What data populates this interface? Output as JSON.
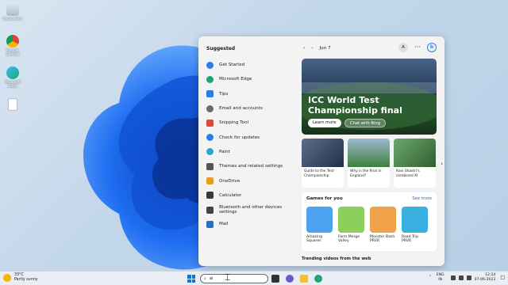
{
  "desktop": {
    "icons": [
      {
        "label": "Recycle Bin",
        "icon": "recycle-bin-icon"
      },
      {
        "label": "Google Chrome",
        "icon": "chrome-icon"
      },
      {
        "label": "Microsoft Edge",
        "icon": "edge-icon"
      },
      {
        "label": "",
        "icon": "file-icon"
      }
    ]
  },
  "search_panel": {
    "suggested_title": "Suggested",
    "suggested": [
      {
        "label": "Get Started",
        "icon": "get-started-icon",
        "color": "#2b7de9"
      },
      {
        "label": "Microsoft Edge",
        "icon": "edge-icon",
        "color": "#1fa37a"
      },
      {
        "label": "Tips",
        "icon": "tips-icon",
        "color": "#2b7de9"
      },
      {
        "label": "Email and accounts",
        "icon": "person-icon",
        "color": "#6b6b6b"
      },
      {
        "label": "Snipping Tool",
        "icon": "snipping-tool-icon",
        "color": "#d94a3a"
      },
      {
        "label": "Check for updates",
        "icon": "update-icon",
        "color": "#2b7de9"
      },
      {
        "label": "Paint",
        "icon": "paint-icon",
        "color": "#2aa5d8"
      },
      {
        "label": "Themes and related settings",
        "icon": "brush-icon",
        "color": "#555555"
      },
      {
        "label": "OneDrive",
        "icon": "onedrive-icon",
        "color": "#e0a020"
      },
      {
        "label": "Calculator",
        "icon": "calculator-icon",
        "color": "#3a3a3a"
      },
      {
        "label": "Bluetooth and other devices settings",
        "icon": "bluetooth-icon",
        "color": "#444444"
      },
      {
        "label": "Mail",
        "icon": "mail-icon",
        "color": "#2b6cc0"
      }
    ],
    "date": "Jun 7",
    "avatar_letter": "A",
    "more_label": "···",
    "bing_label": "b",
    "hero": {
      "title": "ICC World Test Championship final",
      "learn_more": "Learn more",
      "chat_bing": "Chat with Bing"
    },
    "cards": [
      {
        "text": "Guide to the Test Championship"
      },
      {
        "text": "Why is the final in England?"
      },
      {
        "text": "Ravi Shastri's combined XI"
      }
    ],
    "games": {
      "title": "Games for you",
      "see_more": "See more",
      "items": [
        {
          "name": "Amazing Squares",
          "color": "#4da3f0"
        },
        {
          "name": "Farm Merge Valley",
          "color": "#8ccf5a"
        },
        {
          "name": "Monster Bash PRVR",
          "color": "#f0a24a"
        },
        {
          "name": "Road Trip PRVR",
          "color": "#3ab0e0"
        }
      ]
    },
    "trending": "Trending videos from the web"
  },
  "taskbar": {
    "weather_temp": "33°C",
    "weather_desc": "Partly sunny",
    "search_query": "ai",
    "lang_1": "ENG",
    "lang_2": "IN",
    "time": "12:24",
    "date": "07-06-2023"
  },
  "colors": {
    "accent": "#0a74da",
    "link": "#2b6cc0"
  }
}
